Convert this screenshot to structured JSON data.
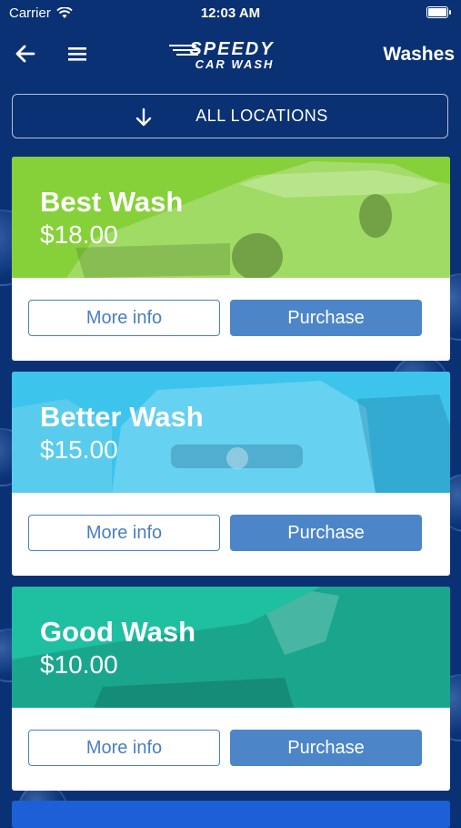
{
  "status_bar": {
    "carrier": "Carrier",
    "time": "12:03 AM"
  },
  "nav": {
    "title": "Washes",
    "logo_top": "SPEEDY",
    "logo_bottom": "CAR WASH"
  },
  "locations": {
    "label": "ALL LOCATIONS"
  },
  "washes": [
    {
      "name": "Best Wash",
      "price": "$18.00",
      "color": "#86d13a",
      "info_label": "More info",
      "buy_label": "Purchase"
    },
    {
      "name": "Better Wash",
      "price": "$15.00",
      "color": "#3cc4ec",
      "info_label": "More info",
      "buy_label": "Purchase"
    },
    {
      "name": "Good Wash",
      "price": "$10.00",
      "color": "#1fbfa2",
      "info_label": "More info",
      "buy_label": "Purchase"
    }
  ],
  "colors": {
    "background": "#0a3173",
    "button": "#4c86c9",
    "accent_partial": "#1d5fd6"
  }
}
